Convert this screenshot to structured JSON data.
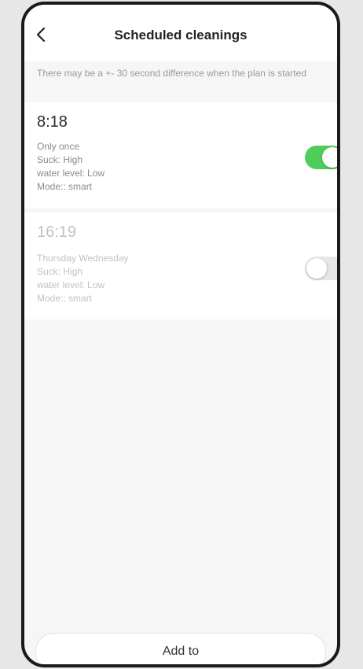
{
  "header": {
    "title": "Scheduled cleanings",
    "back_icon": "chevron-left-icon"
  },
  "notice": "There may be a +- 30 second difference when the plan is started",
  "schedules": [
    {
      "time": "8:18",
      "repeat": "Only once",
      "suck": "Suck: High",
      "water": "water level: Low",
      "mode": "Mode:: smart",
      "enabled": true
    },
    {
      "time": "16:19",
      "repeat": "Thursday Wednesday",
      "suck": "Suck: High",
      "water": "water level: Low",
      "mode": "Mode:: smart",
      "enabled": false
    }
  ],
  "footer": {
    "add_label": "Add to"
  },
  "colors": {
    "toggle_on": "#4fcf5a",
    "toggle_off": "#e6e6e6",
    "background": "#f6f6f6"
  }
}
